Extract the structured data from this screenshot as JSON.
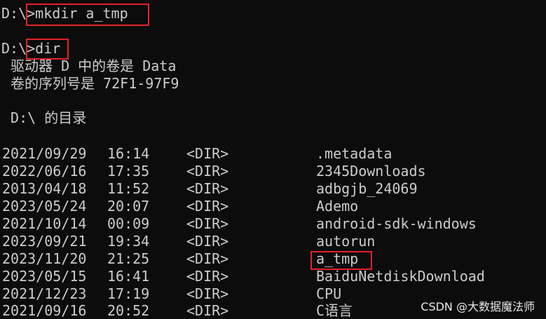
{
  "console": {
    "prompt1": "D:\\>",
    "command1": "mkdir a_tmp",
    "prompt2": "D:\\>",
    "command2": "dir",
    "volume_line": " 驱动器 D 中的卷是 Data",
    "serial_line": " 卷的序列号是 72F1-97F9",
    "directory_line": " D:\\ 的目录",
    "entries": [
      {
        "date": "2021/09/29",
        "time": "16:14",
        "type": "<DIR>",
        "name": ".metadata"
      },
      {
        "date": "2022/06/16",
        "time": "17:35",
        "type": "<DIR>",
        "name": "2345Downloads"
      },
      {
        "date": "2013/04/18",
        "time": "11:52",
        "type": "<DIR>",
        "name": "adbgjb_24069"
      },
      {
        "date": "2023/05/24",
        "time": "20:07",
        "type": "<DIR>",
        "name": "Ademo"
      },
      {
        "date": "2021/10/14",
        "time": "00:09",
        "type": "<DIR>",
        "name": "android-sdk-windows"
      },
      {
        "date": "2023/09/21",
        "time": "19:34",
        "type": "<DIR>",
        "name": "autorun"
      },
      {
        "date": "2023/11/20",
        "time": "21:25",
        "type": "<DIR>",
        "name": "a_tmp"
      },
      {
        "date": "2023/05/15",
        "time": "16:41",
        "type": "<DIR>",
        "name": "BaiduNetdiskDownload"
      },
      {
        "date": "2021/12/23",
        "time": "17:19",
        "type": "<DIR>",
        "name": "CPU"
      },
      {
        "date": "2021/09/16",
        "time": "20:52",
        "type": "<DIR>",
        "name": "C语言"
      }
    ]
  },
  "watermark": "CSDN @大数据魔法师",
  "colors": {
    "background": "#0c0c0c",
    "text": "#cccccc",
    "highlight_box": "#e3222a"
  }
}
